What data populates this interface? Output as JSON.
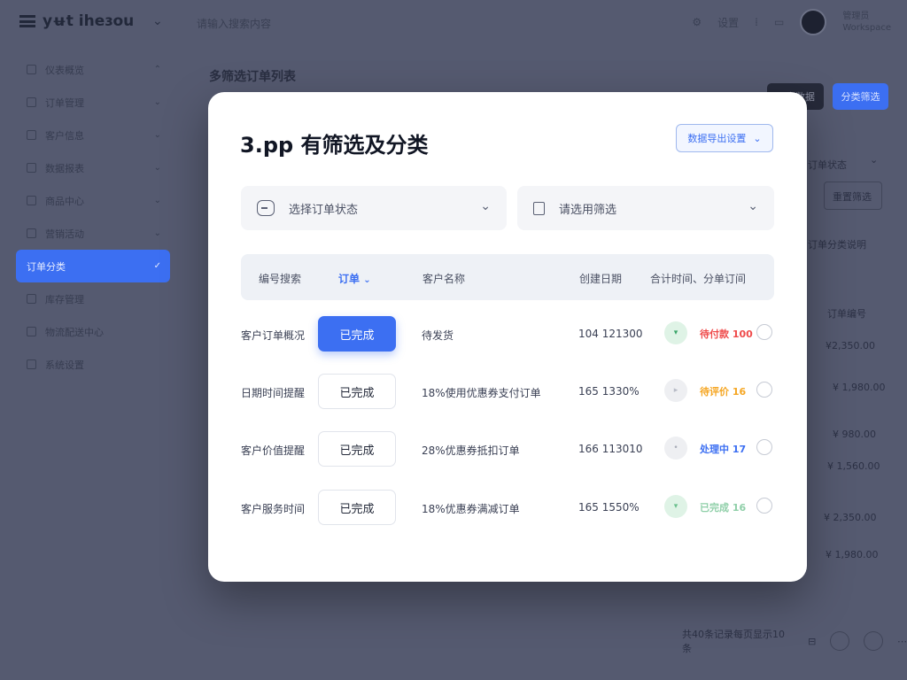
{
  "app": {
    "brand": "yʉt iheɜou",
    "crumb": "请输入搜索内容",
    "top_right": {
      "setting": "设置",
      "user_name": "管理员",
      "user_role": "Workspace"
    }
  },
  "sidebar": {
    "items": [
      {
        "label": "仪表概览",
        "active": false
      },
      {
        "label": "订单管理",
        "active": false
      },
      {
        "label": "客户信息",
        "active": false
      },
      {
        "label": "数据报表",
        "active": false
      },
      {
        "label": "商品中心",
        "active": false
      },
      {
        "label": "营销活动",
        "active": false
      },
      {
        "label": "订单分类",
        "active": true
      },
      {
        "label": "库存管理",
        "active": false
      },
      {
        "label": "物流配送中心",
        "active": false
      },
      {
        "label": "系统设置",
        "active": false
      }
    ]
  },
  "page": {
    "title": "多筛选订单列表",
    "btn_dark": "导出数据",
    "btn_blue": "分类筛选",
    "bg_right": [
      "订单状态",
      "重置筛选",
      "订单分类说明",
      "订单编号",
      "¥2,350.00",
      "¥ 1,980.00",
      "¥ 980.00",
      "¥ 1,560.00",
      "¥ 2,350.00",
      "¥ 1,980.00"
    ],
    "pagination": "共40条记录每页显示10条"
  },
  "modal": {
    "title": "3.pp 有筛选及分类",
    "action_label": "数据导出设置",
    "filter_status_placeholder": "选择订单状态",
    "filter_date_placeholder": "请选用筛选",
    "table_headers": [
      "编号搜索",
      "订单",
      "客户名称",
      "创建日期",
      "合计时间、分单订间"
    ],
    "rows": [
      {
        "name": "客户订单概况",
        "status": "已完成",
        "status_primary": true,
        "desc": "待发货",
        "amount": "104 121300",
        "badge": "待付款 100",
        "badge_color": "#ef4a4a",
        "dot_bg": "#dff3e6",
        "dot_fg": "#3aa66a",
        "dot_icon": "▾"
      },
      {
        "name": "日期时间提醒",
        "status": "已完成",
        "status_primary": false,
        "desc": "18%使用优惠券支付订单",
        "amount": "165 1330%",
        "badge": "待评价 16",
        "badge_color": "#f5a623",
        "dot_bg": "#eeeff2",
        "dot_fg": "#b7bbc6",
        "dot_icon": "▸"
      },
      {
        "name": "客户价值提醒",
        "status": "已完成",
        "status_primary": false,
        "desc": "28%优惠券抵扣订单",
        "amount": "166 113010",
        "badge": "处理中 17",
        "badge_color": "#3c6ff2",
        "dot_bg": "#eeeff2",
        "dot_fg": "#a9adb8",
        "dot_icon": "•"
      },
      {
        "name": "客户服务时间",
        "status": "已完成",
        "status_primary": false,
        "desc": "18%优惠券满减订单",
        "amount": "165 1550%",
        "badge": "已完成 16",
        "badge_color": "#8fcfa8",
        "dot_bg": "#dff3e6",
        "dot_fg": "#6cc08e",
        "dot_icon": "▾"
      }
    ]
  },
  "colors": {
    "accent": "#3c6ff2",
    "overlay": "#555a70",
    "modal_bg": "#ffffff"
  },
  "icons": [
    "menu-logo-icon",
    "chevron-down-icon",
    "gear-icon",
    "bell-icon",
    "search-icon",
    "calendar-icon",
    "check-icon"
  ]
}
